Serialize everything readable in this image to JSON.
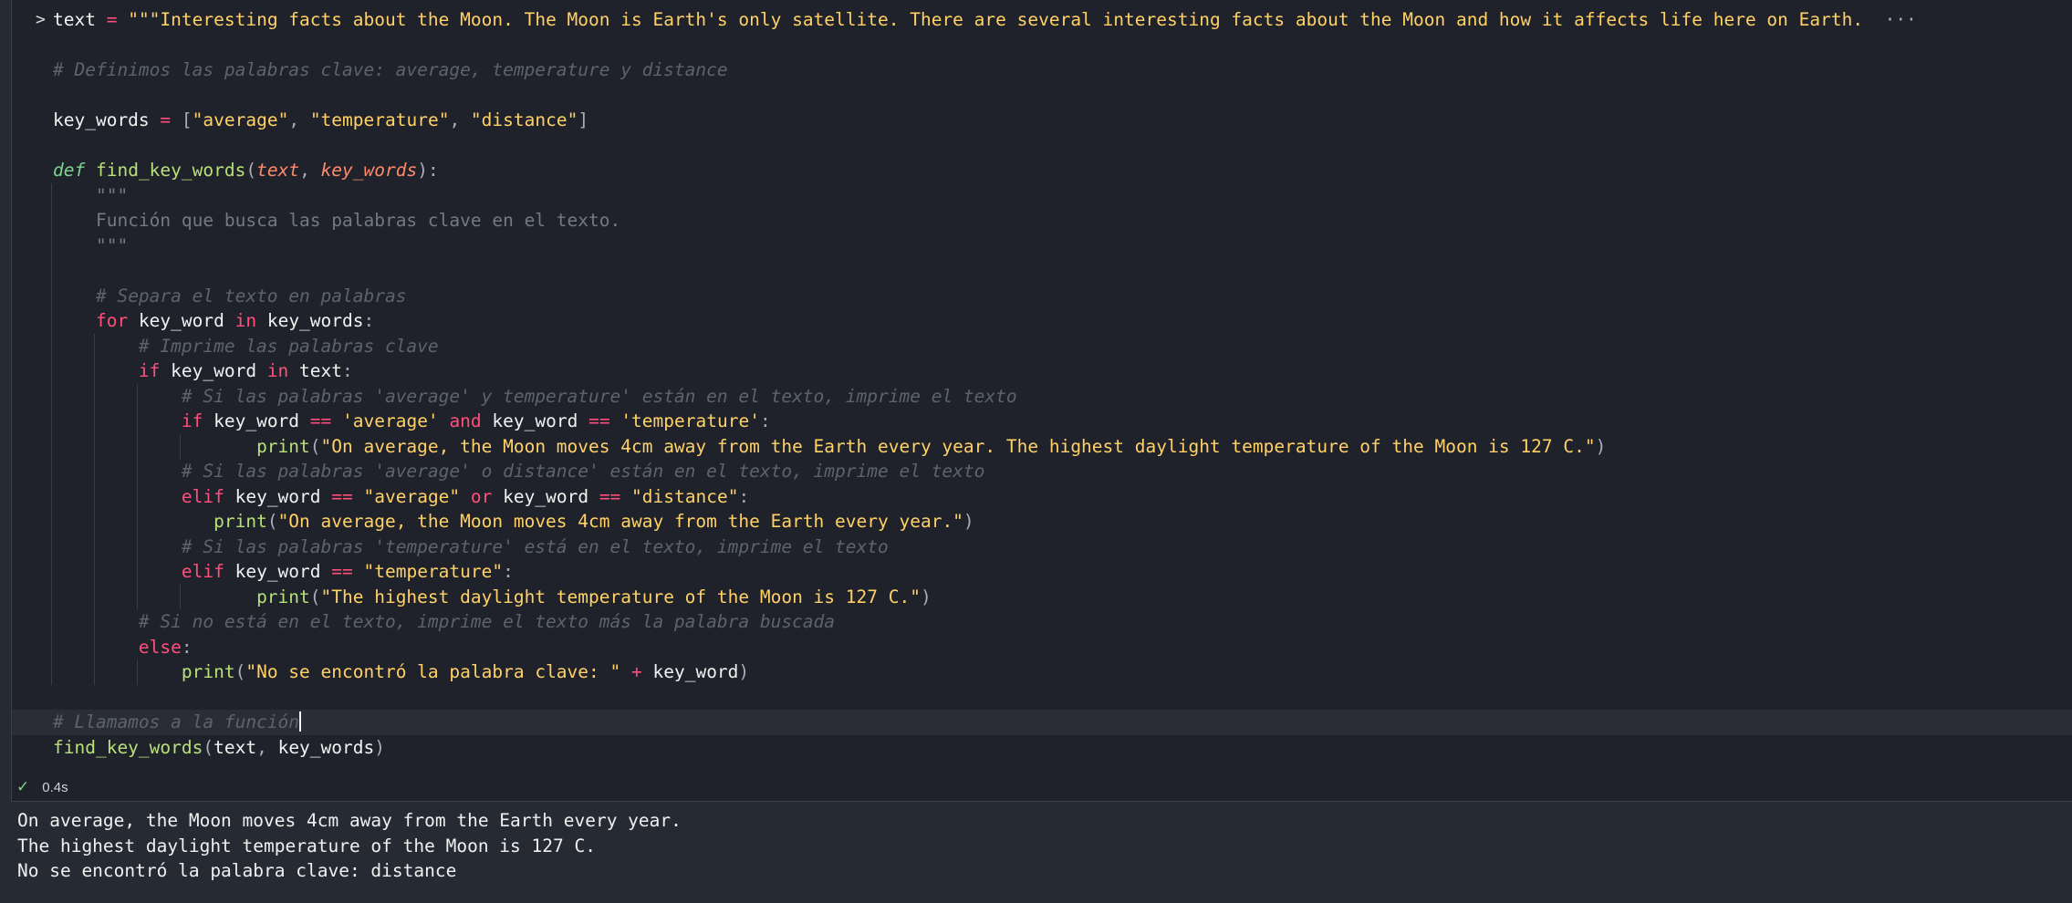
{
  "editor": {
    "lines": [
      {
        "id": "l1",
        "parts": [
          [
            "var",
            "text"
          ],
          [
            "op",
            " = "
          ],
          [
            "str",
            "\"\"\"Interesting facts about the Moon. The Moon is Earth's only satellite. There are several interesting facts about the Moon and how it affects life here on Earth."
          ]
        ],
        "trailing": "···",
        "collapse": ">"
      },
      {
        "id": "l2",
        "parts": []
      },
      {
        "id": "l3",
        "parts": [
          [
            "cmt",
            "# Definimos las palabras clave: average, temperature y distance"
          ]
        ]
      },
      {
        "id": "l4",
        "parts": []
      },
      {
        "id": "l5",
        "parts": [
          [
            "var",
            "key_words"
          ],
          [
            "op",
            " = "
          ],
          [
            "punc",
            "["
          ],
          [
            "str",
            "\"average\""
          ],
          [
            "punc",
            ", "
          ],
          [
            "str",
            "\"temperature\""
          ],
          [
            "punc",
            ", "
          ],
          [
            "str",
            "\"distance\""
          ],
          [
            "punc",
            "]"
          ]
        ]
      },
      {
        "id": "l6",
        "parts": []
      },
      {
        "id": "l7",
        "parts": [
          [
            "def",
            "def"
          ],
          [
            "var",
            " "
          ],
          [
            "fn",
            "find_key_words"
          ],
          [
            "punc",
            "("
          ],
          [
            "param",
            "text"
          ],
          [
            "punc",
            ", "
          ],
          [
            "param",
            "key_words"
          ],
          [
            "punc",
            "):"
          ]
        ]
      },
      {
        "id": "l8",
        "indent": 1,
        "parts": [
          [
            "doc",
            "\"\"\""
          ]
        ]
      },
      {
        "id": "l9",
        "indent": 1,
        "parts": [
          [
            "doc",
            "Función que busca las palabras clave en el texto."
          ]
        ]
      },
      {
        "id": "l10",
        "indent": 1,
        "parts": [
          [
            "doc",
            "\"\"\""
          ]
        ]
      },
      {
        "id": "l11",
        "parts": []
      },
      {
        "id": "l12",
        "indent": 1,
        "parts": [
          [
            "cmt",
            "# Separa el texto en palabras"
          ]
        ]
      },
      {
        "id": "l13",
        "indent": 1,
        "parts": [
          [
            "kw",
            "for"
          ],
          [
            "var",
            " key_word "
          ],
          [
            "kw",
            "in"
          ],
          [
            "var",
            " key_words"
          ],
          [
            "punc",
            ":"
          ]
        ]
      },
      {
        "id": "l14",
        "indent": 2,
        "parts": [
          [
            "cmt",
            "# Imprime las palabras clave"
          ]
        ]
      },
      {
        "id": "l15",
        "indent": 2,
        "parts": [
          [
            "kw",
            "if"
          ],
          [
            "var",
            " key_word "
          ],
          [
            "kw",
            "in"
          ],
          [
            "var",
            " text"
          ],
          [
            "punc",
            ":"
          ]
        ]
      },
      {
        "id": "l16",
        "indent": 3,
        "parts": [
          [
            "cmt",
            "# Si las palabras 'average' y temperature' están en el texto, imprime el texto"
          ]
        ]
      },
      {
        "id": "l17",
        "indent": 3,
        "parts": [
          [
            "kw",
            "if"
          ],
          [
            "var",
            " key_word "
          ],
          [
            "op",
            "=="
          ],
          [
            "var",
            " "
          ],
          [
            "str",
            "'average'"
          ],
          [
            "var",
            " "
          ],
          [
            "kw",
            "and"
          ],
          [
            "var",
            " key_word "
          ],
          [
            "op",
            "=="
          ],
          [
            "var",
            " "
          ],
          [
            "str",
            "'temperature'"
          ],
          [
            "punc",
            ":"
          ]
        ]
      },
      {
        "id": "l18",
        "indent": 4,
        "extra": "   ",
        "parts": [
          [
            "fn",
            "print"
          ],
          [
            "punc",
            "("
          ],
          [
            "str",
            "\"On average, the Moon moves 4cm away from the Earth every year. The highest daylight temperature of the Moon is 127 C.\""
          ],
          [
            "punc",
            ")"
          ]
        ]
      },
      {
        "id": "l19",
        "indent": 3,
        "parts": [
          [
            "cmt",
            "# Si las palabras 'average' o distance' están en el texto, imprime el texto"
          ]
        ]
      },
      {
        "id": "l20",
        "indent": 3,
        "parts": [
          [
            "kw",
            "elif"
          ],
          [
            "var",
            " key_word "
          ],
          [
            "op",
            "=="
          ],
          [
            "var",
            " "
          ],
          [
            "str",
            "\"average\""
          ],
          [
            "var",
            " "
          ],
          [
            "kw",
            "or"
          ],
          [
            "var",
            " key_word "
          ],
          [
            "op",
            "=="
          ],
          [
            "var",
            " "
          ],
          [
            "str",
            "\"distance\""
          ],
          [
            "punc",
            ":"
          ]
        ]
      },
      {
        "id": "l21",
        "indent": 3,
        "extra": "   ",
        "parts": [
          [
            "fn",
            "print"
          ],
          [
            "punc",
            "("
          ],
          [
            "str",
            "\"On average, the Moon moves 4cm away from the Earth every year.\""
          ],
          [
            "punc",
            ")"
          ]
        ]
      },
      {
        "id": "l22",
        "indent": 3,
        "parts": [
          [
            "cmt",
            "# Si las palabras 'temperature' está en el texto, imprime el texto"
          ]
        ]
      },
      {
        "id": "l23",
        "indent": 3,
        "parts": [
          [
            "kw",
            "elif"
          ],
          [
            "var",
            " key_word "
          ],
          [
            "op",
            "=="
          ],
          [
            "var",
            " "
          ],
          [
            "str",
            "\"temperature\""
          ],
          [
            "punc",
            ":"
          ]
        ]
      },
      {
        "id": "l24",
        "indent": 4,
        "extra": "   ",
        "parts": [
          [
            "fn",
            "print"
          ],
          [
            "punc",
            "("
          ],
          [
            "str",
            "\"The highest daylight temperature of the Moon is 127 C.\""
          ],
          [
            "punc",
            ")"
          ]
        ]
      },
      {
        "id": "l25",
        "indent": 2,
        "parts": [
          [
            "cmt",
            "# Si no está en el texto, imprime el texto más la palabra buscada"
          ]
        ]
      },
      {
        "id": "l26",
        "indent": 2,
        "parts": [
          [
            "kw",
            "else"
          ],
          [
            "punc",
            ":"
          ]
        ]
      },
      {
        "id": "l27",
        "indent": 3,
        "parts": [
          [
            "fn",
            "print"
          ],
          [
            "punc",
            "("
          ],
          [
            "str",
            "\"No se encontró la palabra clave: \""
          ],
          [
            "var",
            " "
          ],
          [
            "op",
            "+"
          ],
          [
            "var",
            " key_word"
          ],
          [
            "punc",
            ")"
          ]
        ]
      },
      {
        "id": "l28",
        "parts": []
      },
      {
        "id": "l29",
        "hl": true,
        "cursor": true,
        "parts": [
          [
            "cmt",
            "# Llamamos a la función"
          ]
        ]
      },
      {
        "id": "l30",
        "parts": [
          [
            "fn",
            "find_key_words"
          ],
          [
            "punc",
            "("
          ],
          [
            "var",
            "text"
          ],
          [
            "punc",
            ", "
          ],
          [
            "var",
            "key_words"
          ],
          [
            "punc",
            ")"
          ]
        ]
      }
    ]
  },
  "status": {
    "check_icon": "check-icon",
    "duration": "0.4s"
  },
  "output": {
    "lines": [
      "On average, the Moon moves 4cm away from the Earth every year.",
      "The highest daylight temperature of the Moon is 127 C.",
      "No se encontró la palabra clave: distance"
    ]
  }
}
